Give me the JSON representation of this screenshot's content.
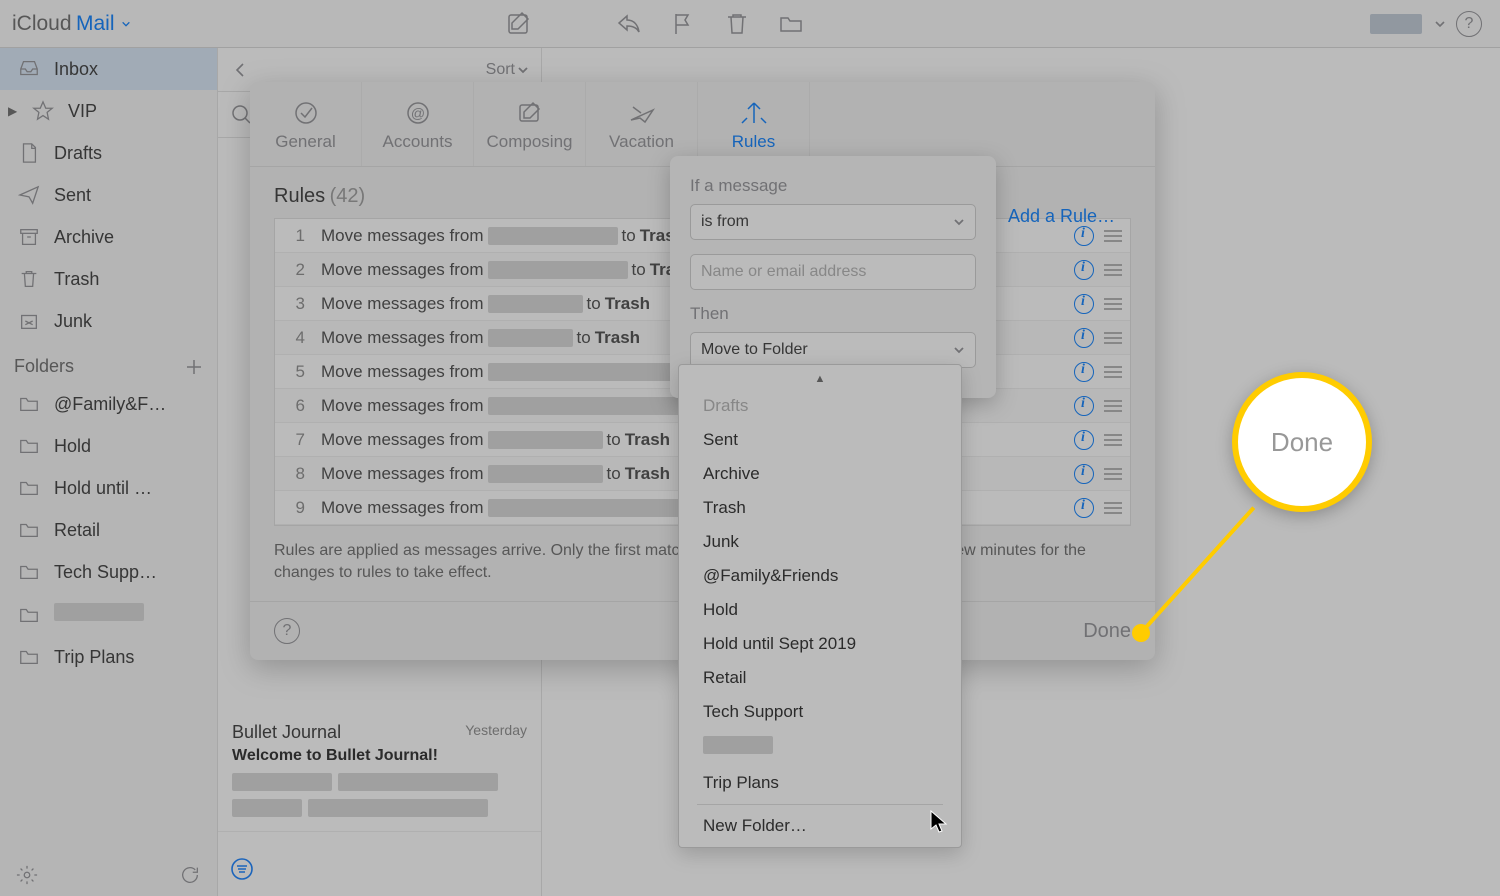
{
  "app": {
    "title_icloud": "iCloud",
    "title_mail": "Mail"
  },
  "sidebar": {
    "inbox": "Inbox",
    "vip": "VIP",
    "drafts": "Drafts",
    "sent": "Sent",
    "archive": "Archive",
    "trash": "Trash",
    "junk": "Junk",
    "folders_header": "Folders",
    "folders": [
      "@Family&F…",
      "Hold",
      "Hold until …",
      "Retail",
      "Tech Supp…",
      "",
      "Trip Plans"
    ]
  },
  "msglist": {
    "sort_label": "Sort",
    "card": {
      "sender": "Bullet Journal",
      "date": "Yesterday",
      "subject": "Welcome to Bullet Journal!"
    }
  },
  "settings": {
    "tabs": {
      "general": "General",
      "accounts": "Accounts",
      "composing": "Composing",
      "vacation": "Vacation",
      "rules": "Rules"
    },
    "rules_label": "Rules",
    "rules_count": "(42)",
    "add_rule": "Add a Rule…",
    "rule_prefix": "Move messages from",
    "rule_to": "to",
    "rule_dest_trash": "Trash",
    "note": "Rules are applied as messages arrive. Only the first matching rule will be applied. It may take a few minutes for the changes to rules to take effect.",
    "done": "Done"
  },
  "popover": {
    "if_label": "If a message",
    "condition": "is from",
    "placeholder": "Name or email address",
    "then_label": "Then",
    "action": "Move to Folder"
  },
  "folder_menu": {
    "items": [
      "Drafts",
      "Sent",
      "Archive",
      "Trash",
      "Junk",
      "@Family&Friends",
      "Hold",
      "Hold until Sept 2019",
      "Retail",
      "Tech Support",
      "",
      "Trip Plans"
    ],
    "new_folder": "New Folder…"
  },
  "callout": {
    "text": "Done"
  }
}
